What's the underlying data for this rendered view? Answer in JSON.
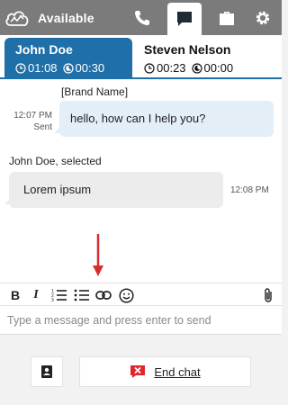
{
  "header": {
    "status_label": "Available",
    "status_icon": "cloud-icon",
    "nav": [
      {
        "name": "phone-icon"
      },
      {
        "name": "chat-icon",
        "active": true
      },
      {
        "name": "briefcase-icon"
      },
      {
        "name": "gear-icon"
      }
    ]
  },
  "tabs": [
    {
      "name": "John Doe",
      "contact_time": "01:08",
      "after_time": "00:30",
      "active": true
    },
    {
      "name": "Steven Nelson",
      "contact_time": "00:23",
      "after_time": "00:00",
      "active": false
    }
  ],
  "messages": {
    "outgoing": {
      "sender": "[Brand Name]",
      "text": "hello, how can I help you?",
      "time": "12:07 PM",
      "status": "Sent"
    },
    "incoming": {
      "sender": "John Doe, selected",
      "text": "Lorem ipsum",
      "time": "12:08 PM"
    }
  },
  "toolbar": {
    "bold": "B",
    "italic": "I"
  },
  "composer": {
    "placeholder": "Type a message and press enter to send",
    "value": ""
  },
  "footer": {
    "end_chat_label": "End chat"
  },
  "colors": {
    "topbar": "#7b7b7b",
    "accent": "#1f6fa8",
    "danger": "#e0262d",
    "annotation_arrow": "#d32f2f"
  }
}
